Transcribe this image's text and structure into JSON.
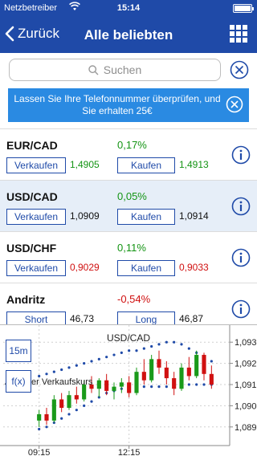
{
  "status_bar": {
    "carrier": "Netzbetreiber",
    "time": "15:14",
    "battery_level": 1.0
  },
  "nav": {
    "back_label": "Zurück",
    "title": "Alle beliebten"
  },
  "search": {
    "placeholder": "Suchen"
  },
  "promo": {
    "text": "Lassen Sie Ihre Telefonnummer überprüfen, und Sie erhalten 25€"
  },
  "instruments": [
    {
      "symbol": "EUR/CAD",
      "change": "0,17%",
      "change_color": "#149414",
      "sell_label": "Verkaufen",
      "sell_price": "1,4905",
      "sell_color": "#149414",
      "buy_label": "Kaufen",
      "buy_price": "1,4913",
      "buy_color": "#149414",
      "highlighted": false
    },
    {
      "symbol": "USD/CAD",
      "change": "0,05%",
      "change_color": "#149414",
      "sell_label": "Verkaufen",
      "sell_price": "1,0909",
      "sell_color": "#111111",
      "buy_label": "Kaufen",
      "buy_price": "1,0914",
      "buy_color": "#111111",
      "highlighted": true
    },
    {
      "symbol": "USD/CHF",
      "change": "0,11%",
      "change_color": "#149414",
      "sell_label": "Verkaufen",
      "sell_price": "0,9029",
      "sell_color": "#d01010",
      "buy_label": "Kaufen",
      "buy_price": "0,9033",
      "buy_color": "#d01010",
      "highlighted": false
    },
    {
      "symbol": "Andritz",
      "change": "-0,54%",
      "change_color": "#d01010",
      "sell_label": "Short",
      "sell_price": "46,73",
      "sell_color": "#111111",
      "buy_label": "Long",
      "buy_price": "46,87",
      "buy_color": "#111111",
      "highlighted": false
    }
  ],
  "chart_panel": {
    "timeframe_label": "15m",
    "indicator_label": "f(x)",
    "overlay_text": "Aktueller Verkaufskurs"
  },
  "chart_data": {
    "type": "candlestick",
    "title": "USD/CAD",
    "x_tick_labels": [
      "09:15",
      "12:15"
    ],
    "y_tick_labels": [
      "1,0930",
      "1,0920",
      "1,0910",
      "1,0900",
      "1,0890"
    ],
    "ylim": [
      1.0885,
      1.0935
    ],
    "up_color": "#1a9a1a",
    "down_color": "#d01010",
    "indicator_color": "#1f4aa8",
    "candles": [
      {
        "o": 1.0893,
        "h": 1.0898,
        "l": 1.089,
        "c": 1.0896
      },
      {
        "o": 1.0896,
        "h": 1.0899,
        "l": 1.0891,
        "c": 1.0893
      },
      {
        "o": 1.0893,
        "h": 1.0905,
        "l": 1.0892,
        "c": 1.0903
      },
      {
        "o": 1.0903,
        "h": 1.0906,
        "l": 1.0897,
        "c": 1.0899
      },
      {
        "o": 1.0899,
        "h": 1.0907,
        "l": 1.0898,
        "c": 1.0905
      },
      {
        "o": 1.0905,
        "h": 1.0909,
        "l": 1.0901,
        "c": 1.0903
      },
      {
        "o": 1.0903,
        "h": 1.0912,
        "l": 1.0902,
        "c": 1.091
      },
      {
        "o": 1.091,
        "h": 1.0914,
        "l": 1.0906,
        "c": 1.0908
      },
      {
        "o": 1.0908,
        "h": 1.0913,
        "l": 1.0904,
        "c": 1.0912
      },
      {
        "o": 1.0912,
        "h": 1.0915,
        "l": 1.0905,
        "c": 1.0907
      },
      {
        "o": 1.0907,
        "h": 1.0911,
        "l": 1.0903,
        "c": 1.0909
      },
      {
        "o": 1.0909,
        "h": 1.0913,
        "l": 1.0906,
        "c": 1.0911
      },
      {
        "o": 1.0911,
        "h": 1.0914,
        "l": 1.0904,
        "c": 1.0906
      },
      {
        "o": 1.0906,
        "h": 1.0918,
        "l": 1.0905,
        "c": 1.0916
      },
      {
        "o": 1.0916,
        "h": 1.0922,
        "l": 1.091,
        "c": 1.0912
      },
      {
        "o": 1.0912,
        "h": 1.0924,
        "l": 1.0911,
        "c": 1.0922
      },
      {
        "o": 1.0922,
        "h": 1.0926,
        "l": 1.0915,
        "c": 1.0918
      },
      {
        "o": 1.0918,
        "h": 1.0921,
        "l": 1.091,
        "c": 1.0913
      },
      {
        "o": 1.0913,
        "h": 1.0916,
        "l": 1.0905,
        "c": 1.0908
      },
      {
        "o": 1.0908,
        "h": 1.092,
        "l": 1.0907,
        "c": 1.0918
      },
      {
        "o": 1.0918,
        "h": 1.0923,
        "l": 1.0912,
        "c": 1.0914
      },
      {
        "o": 1.0914,
        "h": 1.0926,
        "l": 1.0913,
        "c": 1.0924
      },
      {
        "o": 1.0924,
        "h": 1.0925,
        "l": 1.0912,
        "c": 1.0915
      },
      {
        "o": 1.0915,
        "h": 1.0919,
        "l": 1.0908,
        "c": 1.091
      }
    ],
    "indicator_series": {
      "lower": [
        1.0889,
        1.089,
        1.0892,
        1.0894,
        1.0896,
        1.0898,
        1.09,
        1.0902,
        1.0904,
        1.0906,
        1.0907,
        1.0908,
        1.0909,
        1.0909,
        1.0909,
        1.0909,
        1.0909,
        1.0909,
        1.0909,
        1.091,
        1.091,
        1.091,
        1.091,
        1.091
      ],
      "upper": [
        1.0914,
        1.0915,
        1.0916,
        1.0917,
        1.0918,
        1.0919,
        1.092,
        1.0921,
        1.0922,
        1.0923,
        1.0924,
        1.0925,
        1.0926,
        1.0926,
        1.0927,
        1.0928,
        1.0929,
        1.093,
        1.093,
        1.0929,
        1.0927,
        1.0925,
        1.0923,
        1.0921
      ]
    }
  }
}
